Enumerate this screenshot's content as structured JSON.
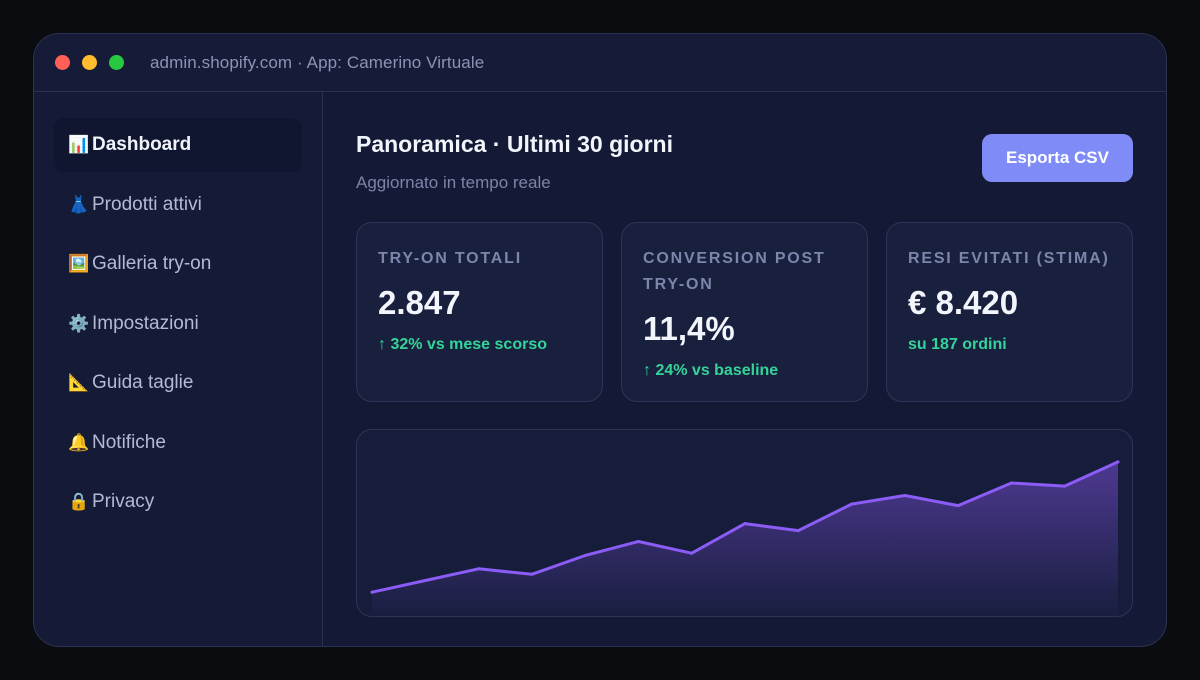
{
  "window": {
    "title": "admin.shopify.com · App: Camerino Virtuale"
  },
  "sidebar": {
    "items": [
      {
        "icon": "📊",
        "icon_name": "bar-chart-icon",
        "label": "Dashboard",
        "active": true
      },
      {
        "icon": "👗",
        "icon_name": "dress-icon",
        "label": "Prodotti attivi",
        "active": false
      },
      {
        "icon": "🖼️",
        "icon_name": "picture-icon",
        "label": "Galleria try-on",
        "active": false
      },
      {
        "icon": "⚙️",
        "icon_name": "gear-icon",
        "label": "Impostazioni",
        "active": false
      },
      {
        "icon": "📐",
        "icon_name": "ruler-icon",
        "label": "Guida taglie",
        "active": false
      },
      {
        "icon": "🔔",
        "icon_name": "bell-icon",
        "label": "Notifiche",
        "active": false
      },
      {
        "icon": "🔒",
        "icon_name": "lock-icon",
        "label": "Privacy",
        "active": false
      }
    ]
  },
  "header": {
    "title": "Panoramica · Ultimi 30 giorni",
    "subtitle": "Aggiornato in tempo reale",
    "export_label": "Esporta CSV"
  },
  "cards": [
    {
      "label": "TRY-ON TOTALI",
      "value": "2.847",
      "delta": "↑ 32% vs mese scorso"
    },
    {
      "label": "CONVERSION POST TRY-ON",
      "value": "11,4%",
      "delta": "↑ 24% vs baseline"
    },
    {
      "label": "RESI EVITATI (STIMA)",
      "value": "€ 8.420",
      "delta": "su 187 ordini"
    }
  ],
  "colors": {
    "accent": "#7f8cf8",
    "positive": "#35d39a",
    "line": "#8b5cf6"
  },
  "chart_data": {
    "type": "area",
    "x": [
      1,
      2,
      3,
      4,
      5,
      6,
      7,
      8,
      9,
      10,
      11,
      12,
      13,
      14,
      15
    ],
    "values": [
      10,
      25,
      40,
      33,
      57,
      75,
      60,
      98,
      89,
      123,
      134,
      121,
      150,
      146,
      177
    ],
    "ylim": [
      0,
      200
    ],
    "grid": false,
    "title": "",
    "xlabel": "",
    "ylabel": ""
  }
}
